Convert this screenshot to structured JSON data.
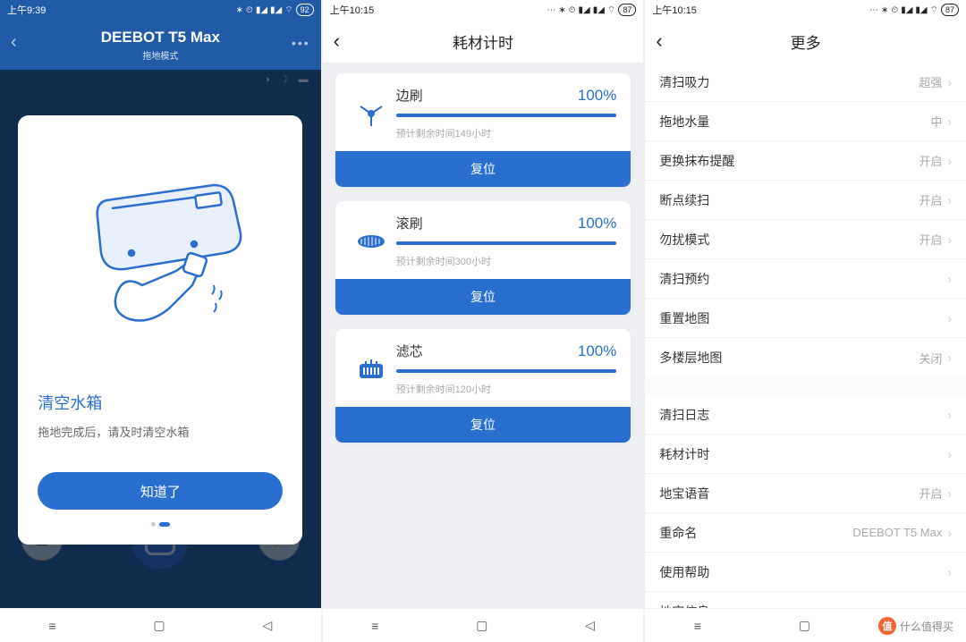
{
  "screen1": {
    "status": {
      "time": "上午9:39",
      "battery": "92"
    },
    "header": {
      "title": "DEEBOT T5 Max",
      "subtitle": "拖地模式"
    },
    "modal": {
      "title": "清空水箱",
      "desc": "拖地完成后，请及时清空水箱",
      "button": "知道了"
    }
  },
  "screen2": {
    "status": {
      "time": "上午10:15",
      "battery": "87"
    },
    "title": "耗材计时",
    "items": [
      {
        "icon": "side-brush",
        "name": "边刷",
        "percent": "100%",
        "remain": "预计剩余时间149小时",
        "reset": "复位"
      },
      {
        "icon": "roll-brush",
        "name": "滚刷",
        "percent": "100%",
        "remain": "预计剩余时间300小时",
        "reset": "复位"
      },
      {
        "icon": "filter",
        "name": "滤芯",
        "percent": "100%",
        "remain": "预计剩余时间120小时",
        "reset": "复位"
      }
    ]
  },
  "screen3": {
    "status": {
      "time": "上午10:15",
      "battery": "87"
    },
    "title": "更多",
    "group1": [
      {
        "label": "清扫吸力",
        "value": "超强"
      },
      {
        "label": "拖地水量",
        "value": "中"
      },
      {
        "label": "更换抹布提醒",
        "value": "开启"
      },
      {
        "label": "断点续扫",
        "value": "开启"
      },
      {
        "label": "勿扰模式",
        "value": "开启"
      },
      {
        "label": "清扫预约",
        "value": ""
      },
      {
        "label": "重置地图",
        "value": ""
      },
      {
        "label": "多楼层地图",
        "value": "关闭"
      }
    ],
    "group2": [
      {
        "label": "清扫日志",
        "value": ""
      },
      {
        "label": "耗材计时",
        "value": ""
      },
      {
        "label": "地宝语音",
        "value": "开启"
      },
      {
        "label": "重命名",
        "value": "DEEBOT T5 Max"
      },
      {
        "label": "使用帮助",
        "value": ""
      },
      {
        "label": "地宝信息",
        "value": ""
      }
    ]
  },
  "watermark": "什么值得买",
  "icons": {
    "bluetooth": "✱",
    "alarm": "⏰",
    "signal": "📶",
    "wifi": "📡"
  }
}
